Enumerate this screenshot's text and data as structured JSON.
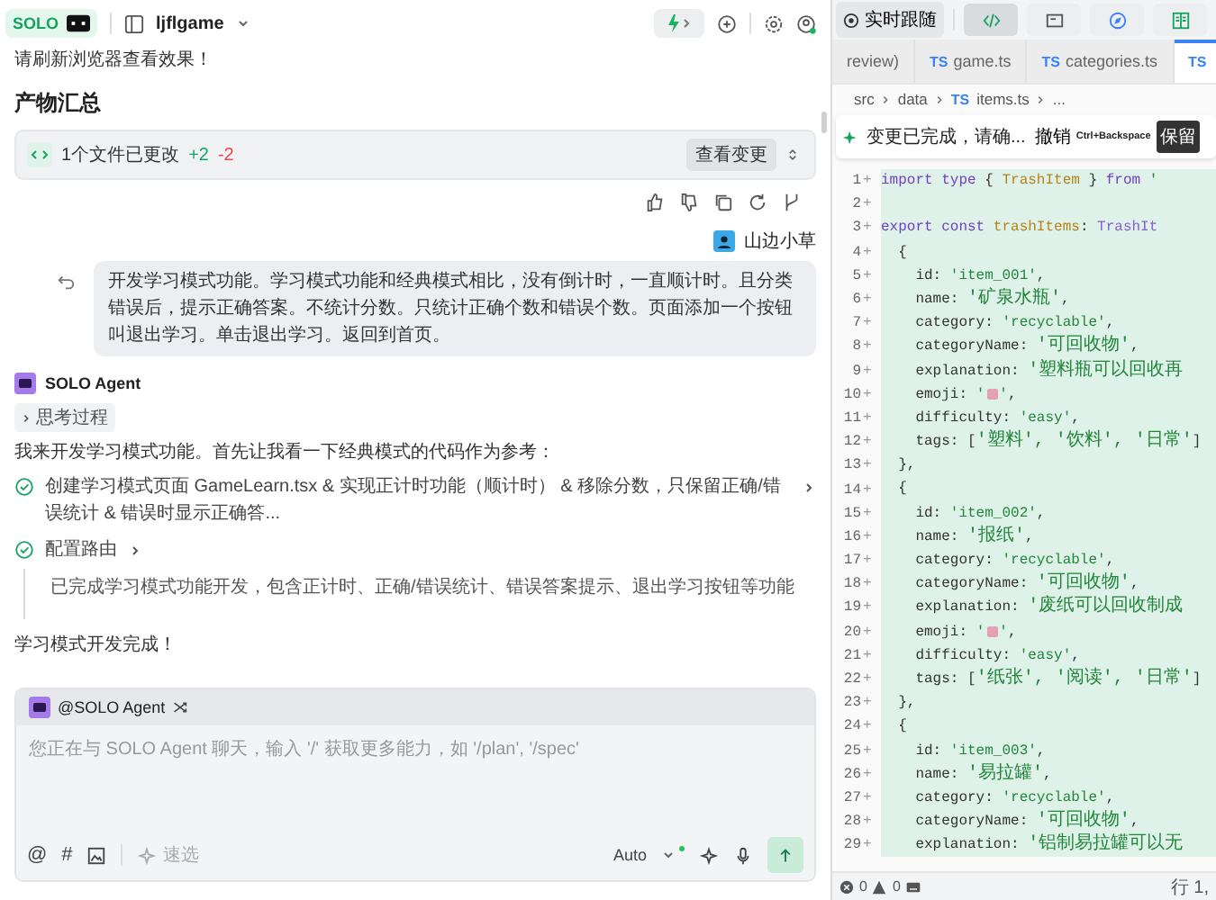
{
  "topbar": {
    "logo": "SOLO",
    "project": "ljflgame"
  },
  "chat": {
    "refresh_note": "请刷新浏览器查看效果！",
    "summary_title": "产物汇总",
    "changes": {
      "text": "1个文件已更改",
      "added": "+2",
      "removed": "-2",
      "button": "查看变更"
    },
    "user": {
      "name": "山边小草",
      "message": "开发学习模式功能。学习模式功能和经典模式相比，没有倒计时，一直顺计时。且分类错误后，提示正确答案。不统计分数。只统计正确个数和错误个数。页面添加一个按钮叫退出学习。单击退出学习。返回到首页。"
    },
    "agent": {
      "name": "SOLO Agent",
      "thinking": "思考过程",
      "intro": "我来开发学习模式功能。首先让我看一下经典模式的代码作为参考：",
      "steps": [
        {
          "text": "创建学习模式页面 GameLearn.tsx & 实现正计时功能（顺计时） & 移除分数，只保留正确/错误统计 & 错误时显示正确答...",
          "done": true
        },
        {
          "text": "配置路由",
          "done": true
        }
      ],
      "result": "已完成学习模式功能开发，包含正计时、正确/错误统计、错误答案提示、退出学习按钮等功能",
      "done_text": "学习模式开发完成！"
    }
  },
  "composer": {
    "mention": "@SOLO Agent",
    "placeholder": "您正在与 SOLO Agent 聊天，输入 '/' 获取更多能力，如 '/plan', '/spec'",
    "at_symbol": "@",
    "hash_symbol": "#",
    "quick": "速选",
    "model": "Auto"
  },
  "editor": {
    "follow": "实时跟随",
    "view_tabs": [
      {
        "kind": "code",
        "selected": true
      },
      {
        "kind": "terminal",
        "selected": false
      },
      {
        "kind": "browser",
        "selected": false
      },
      {
        "kind": "book",
        "selected": false
      }
    ],
    "file_tabs": [
      {
        "label": "review)",
        "selected": false
      },
      {
        "badge": "TS",
        "label": "game.ts",
        "selected": false
      },
      {
        "badge": "TS",
        "label": "categories.ts",
        "selected": false
      },
      {
        "badge": "TS",
        "selected": true
      }
    ],
    "breadcrumb": [
      {
        "text": "src"
      },
      {
        "text": "data"
      },
      {
        "badge": "TS",
        "text": "items.ts"
      },
      {
        "text": "..."
      }
    ],
    "diff_bar": {
      "message": "变更已完成，请确...",
      "undo": "撤销",
      "shortcut": "Ctrl+Backspace",
      "keep": "保留"
    },
    "lines": [
      {
        "num": "1",
        "mark": "+",
        "added": true,
        "tokens": [
          {
            "kind": "keyword",
            "text": "import type "
          },
          {
            "kind": "plain",
            "text": "{ "
          },
          {
            "kind": "name",
            "text": "TrashItem"
          },
          {
            "kind": "plain",
            "text": " } "
          },
          {
            "kind": "keyword",
            "text": "from "
          },
          {
            "kind": "string",
            "text": "'"
          }
        ]
      },
      {
        "num": "2",
        "mark": "+",
        "added": true
      },
      {
        "num": "3",
        "mark": "+",
        "added": true,
        "tokens": [
          {
            "kind": "keyword",
            "text": "export const "
          },
          {
            "kind": "name",
            "text": "trashItems"
          },
          {
            "kind": "plain",
            "text": ": "
          },
          {
            "kind": "type",
            "text": "TrashIt"
          }
        ]
      },
      {
        "num": "4",
        "mark": "+",
        "added": true,
        "tokens": [
          {
            "kind": "plain",
            "text": "  {"
          }
        ]
      },
      {
        "num": "5",
        "mark": "+",
        "added": true,
        "tokens": [
          {
            "kind": "plain",
            "text": "    id: "
          },
          {
            "kind": "string",
            "text": "'item_001'"
          },
          {
            "kind": "plain",
            "text": ","
          }
        ]
      },
      {
        "num": "6",
        "mark": "+",
        "added": true,
        "tokens": [
          {
            "kind": "plain",
            "text": "    name: "
          },
          {
            "kind": "zh",
            "text": "'矿泉水瓶'"
          },
          {
            "kind": "plain",
            "text": ","
          }
        ]
      },
      {
        "num": "7",
        "mark": "+",
        "added": true,
        "tokens": [
          {
            "kind": "plain",
            "text": "    category: "
          },
          {
            "kind": "string",
            "text": "'recyclable'"
          },
          {
            "kind": "plain",
            "text": ","
          }
        ]
      },
      {
        "num": "8",
        "mark": "+",
        "added": true,
        "tokens": [
          {
            "kind": "plain",
            "text": "    categoryName: "
          },
          {
            "kind": "zh",
            "text": "'可回收物'"
          },
          {
            "kind": "plain",
            "text": ","
          }
        ]
      },
      {
        "num": "9",
        "mark": "+",
        "added": true,
        "tokens": [
          {
            "kind": "plain",
            "text": "    explanation: "
          },
          {
            "kind": "zh",
            "text": "'塑料瓶可以回收再"
          }
        ]
      },
      {
        "num": "10",
        "mark": "+",
        "added": true,
        "tokens": [
          {
            "kind": "plain",
            "text": "    emoji: "
          },
          {
            "kind": "string",
            "text": "'"
          },
          {
            "kind": "emoji"
          },
          {
            "kind": "string",
            "text": "'"
          },
          {
            "kind": "plain",
            "text": ","
          }
        ]
      },
      {
        "num": "11",
        "mark": "+",
        "added": true,
        "tokens": [
          {
            "kind": "plain",
            "text": "    difficulty: "
          },
          {
            "kind": "string",
            "text": "'easy'"
          },
          {
            "kind": "plain",
            "text": ","
          }
        ]
      },
      {
        "num": "12",
        "mark": "+",
        "added": true,
        "tokens": [
          {
            "kind": "plain",
            "text": "    tags: ["
          },
          {
            "kind": "zh",
            "text": "'塑料', '饮料', '日常'"
          },
          {
            "kind": "plain",
            "text": "]"
          }
        ]
      },
      {
        "num": "13",
        "mark": "+",
        "added": true,
        "tokens": [
          {
            "kind": "plain",
            "text": "  },"
          }
        ]
      },
      {
        "num": "14",
        "mark": "+",
        "added": true,
        "tokens": [
          {
            "kind": "plain",
            "text": "  {"
          }
        ]
      },
      {
        "num": "15",
        "mark": "+",
        "added": true,
        "tokens": [
          {
            "kind": "plain",
            "text": "    id: "
          },
          {
            "kind": "string",
            "text": "'item_002'"
          },
          {
            "kind": "plain",
            "text": ","
          }
        ]
      },
      {
        "num": "16",
        "mark": "+",
        "added": true,
        "tokens": [
          {
            "kind": "plain",
            "text": "    name: "
          },
          {
            "kind": "zh",
            "text": "'报纸'"
          },
          {
            "kind": "plain",
            "text": ","
          }
        ]
      },
      {
        "num": "17",
        "mark": "+",
        "added": true,
        "tokens": [
          {
            "kind": "plain",
            "text": "    category: "
          },
          {
            "kind": "string",
            "text": "'recyclable'"
          },
          {
            "kind": "plain",
            "text": ","
          }
        ]
      },
      {
        "num": "18",
        "mark": "+",
        "added": true,
        "tokens": [
          {
            "kind": "plain",
            "text": "    categoryName: "
          },
          {
            "kind": "zh",
            "text": "'可回收物'"
          },
          {
            "kind": "plain",
            "text": ","
          }
        ]
      },
      {
        "num": "19",
        "mark": "+",
        "added": true,
        "tokens": [
          {
            "kind": "plain",
            "text": "    explanation: "
          },
          {
            "kind": "zh",
            "text": "'废纸可以回收制成"
          }
        ]
      },
      {
        "num": "20",
        "mark": "+",
        "added": true,
        "tokens": [
          {
            "kind": "plain",
            "text": "    emoji: "
          },
          {
            "kind": "string",
            "text": "'"
          },
          {
            "kind": "emoji"
          },
          {
            "kind": "string",
            "text": "'"
          },
          {
            "kind": "plain",
            "text": ","
          }
        ]
      },
      {
        "num": "21",
        "mark": "+",
        "added": true,
        "tokens": [
          {
            "kind": "plain",
            "text": "    difficulty: "
          },
          {
            "kind": "string",
            "text": "'easy'"
          },
          {
            "kind": "plain",
            "text": ","
          }
        ]
      },
      {
        "num": "22",
        "mark": "+",
        "added": true,
        "tokens": [
          {
            "kind": "plain",
            "text": "    tags: ["
          },
          {
            "kind": "zh",
            "text": "'纸张', '阅读', '日常'"
          },
          {
            "kind": "plain",
            "text": "]"
          }
        ]
      },
      {
        "num": "23",
        "mark": "+",
        "added": true,
        "tokens": [
          {
            "kind": "plain",
            "text": "  },"
          }
        ]
      },
      {
        "num": "24",
        "mark": "+",
        "added": true,
        "tokens": [
          {
            "kind": "plain",
            "text": "  {"
          }
        ]
      },
      {
        "num": "25",
        "mark": "+",
        "added": true,
        "tokens": [
          {
            "kind": "plain",
            "text": "    id: "
          },
          {
            "kind": "string",
            "text": "'item_003'"
          },
          {
            "kind": "plain",
            "text": ","
          }
        ]
      },
      {
        "num": "26",
        "mark": "+",
        "added": true,
        "tokens": [
          {
            "kind": "plain",
            "text": "    name: "
          },
          {
            "kind": "zh",
            "text": "'易拉罐'"
          },
          {
            "kind": "plain",
            "text": ","
          }
        ]
      },
      {
        "num": "27",
        "mark": "+",
        "added": true,
        "tokens": [
          {
            "kind": "plain",
            "text": "    category: "
          },
          {
            "kind": "string",
            "text": "'recyclable'"
          },
          {
            "kind": "plain",
            "text": ","
          }
        ]
      },
      {
        "num": "28",
        "mark": "+",
        "added": true,
        "tokens": [
          {
            "kind": "plain",
            "text": "    categoryName: "
          },
          {
            "kind": "zh",
            "text": "'可回收物'"
          },
          {
            "kind": "plain",
            "text": ","
          }
        ]
      },
      {
        "num": "29",
        "mark": "+",
        "added": true,
        "tokens": [
          {
            "kind": "plain",
            "text": "    explanation: "
          },
          {
            "kind": "zh",
            "text": "'铝制易拉罐可以无"
          }
        ]
      }
    ],
    "status": {
      "errors": "0",
      "warnings": "0",
      "position": "行 1,"
    }
  }
}
